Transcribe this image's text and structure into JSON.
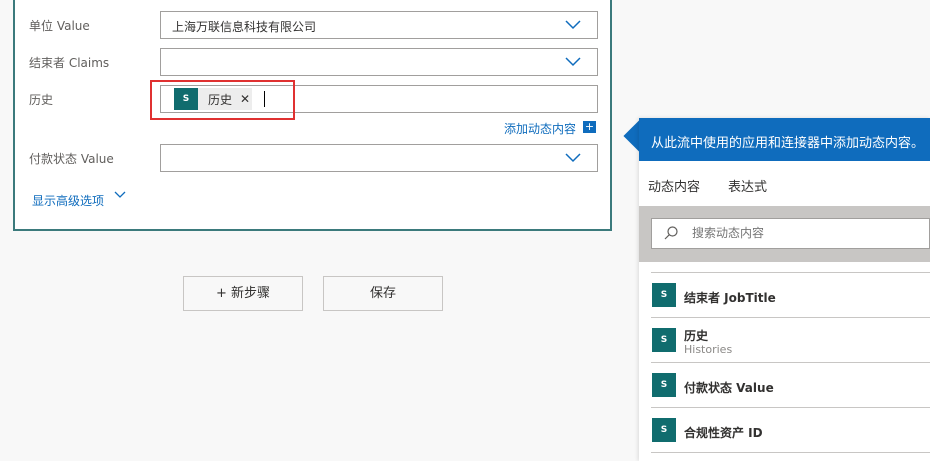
{
  "form": {
    "fields": [
      {
        "label": "单位 Value",
        "value": "上海万联信息科技有限公司"
      },
      {
        "label": "结束者 Claims",
        "value": ""
      },
      {
        "label": "历史",
        "token": "历史"
      },
      {
        "label": "付款状态 Value",
        "value": ""
      }
    ],
    "add_dynamic": "添加动态内容",
    "show_advanced": "显示高级选项"
  },
  "buttons": {
    "new_step": "+ 新步骤",
    "save": "保存"
  },
  "panel": {
    "header": "从此流中使用的应用和连接器中添加动态内容。",
    "tabs": [
      "动态内容",
      "表达式"
    ],
    "search_placeholder": "搜索动态内容",
    "items": [
      {
        "title": "结束者 JobTitle",
        "subtitle": ""
      },
      {
        "title": "历史",
        "subtitle": "Histories"
      },
      {
        "title": "付款状态 Value",
        "subtitle": ""
      },
      {
        "title": "合规性资产 ID",
        "subtitle": ""
      }
    ]
  },
  "colors": {
    "accent": "#0f6cbd",
    "sharepoint": "#106c6e",
    "highlight": "#e03131"
  },
  "icons": [
    "chevron-down-icon",
    "sharepoint-icon",
    "close-icon",
    "plus-icon",
    "search-icon"
  ]
}
